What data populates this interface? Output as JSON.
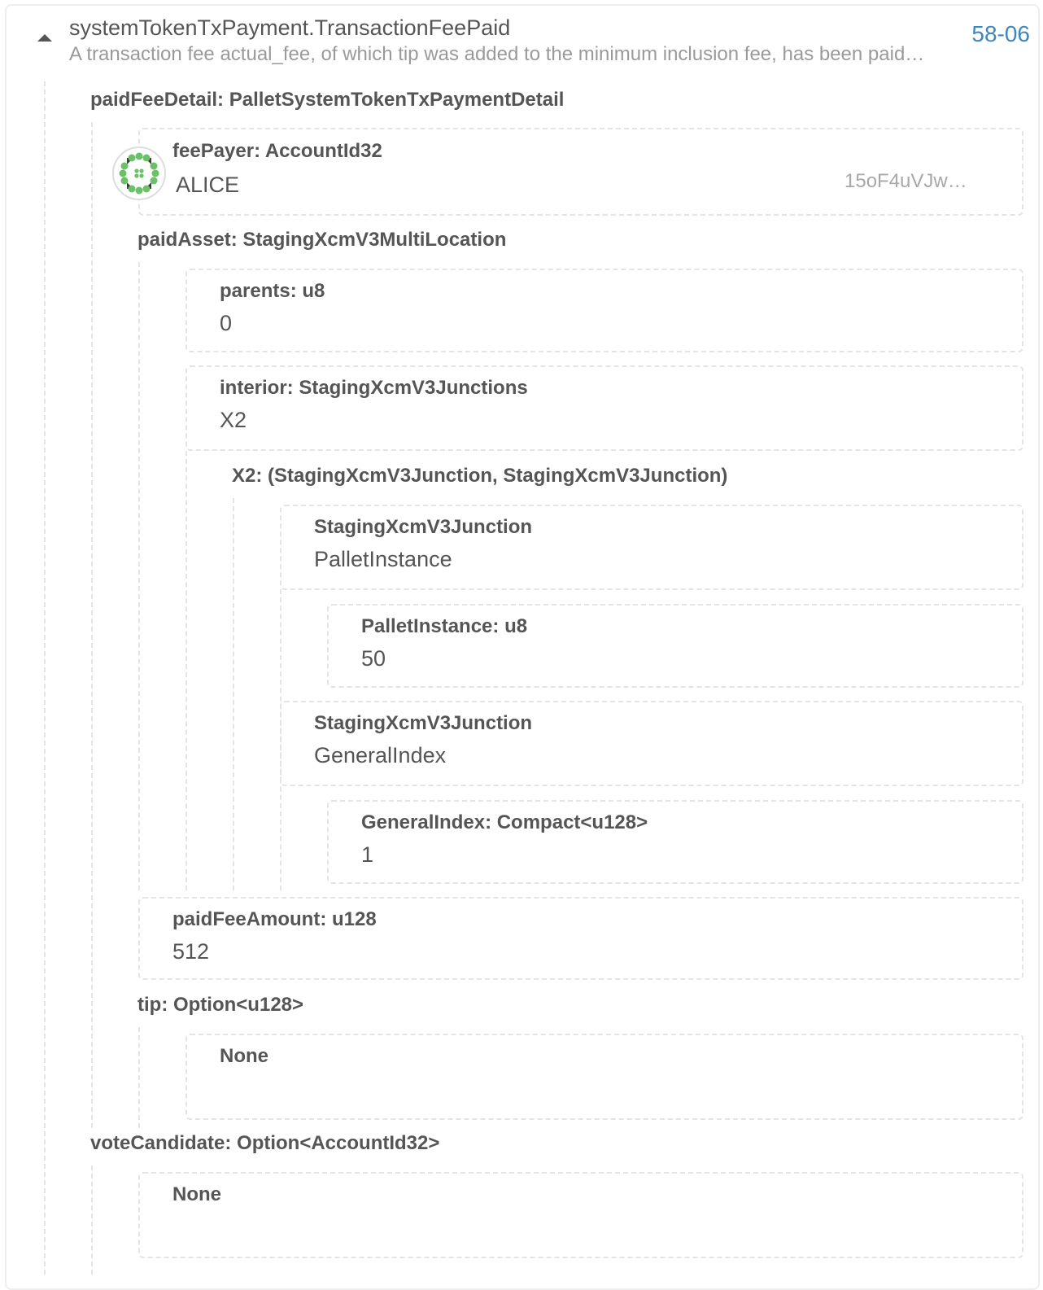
{
  "event": {
    "title": "systemTokenTxPayment.TransactionFeePaid",
    "description": "A transaction fee actual_fee, of which tip was added to the minimum inclusion fee, has been paid…",
    "link": "58-06"
  },
  "params": {
    "paid_fee_detail": {
      "label": "paidFeeDetail: PalletSystemTokenTxPaymentDetail",
      "fee_payer": {
        "label": "feePayer: AccountId32",
        "name": "ALICE",
        "address": "15oF4uVJw…"
      },
      "paid_asset": {
        "label": "paidAsset: StagingXcmV3MultiLocation",
        "parents": {
          "label": "parents: u8",
          "value": "0"
        },
        "interior": {
          "label": "interior: StagingXcmV3Junctions",
          "value": "X2",
          "x2_label": "X2: (StagingXcmV3Junction, StagingXcmV3Junction)",
          "junction_1": {
            "label": "StagingXcmV3Junction",
            "value": "PalletInstance",
            "inner": {
              "label": "PalletInstance: u8",
              "value": "50"
            }
          },
          "junction_2": {
            "label": "StagingXcmV3Junction",
            "value": "GeneralIndex",
            "inner": {
              "label": "GeneralIndex: Compact<u128>",
              "value": "1"
            }
          }
        }
      },
      "paid_fee_amount": {
        "label": "paidFeeAmount: u128",
        "value": "512"
      },
      "tip": {
        "label": "tip: Option<u128>",
        "value": "None"
      }
    },
    "vote_candidate": {
      "label": "voteCandidate: Option<AccountId32>",
      "value": "None"
    }
  },
  "colors": {
    "link": "#3f86bd",
    "dashed_border": "#e4e4e4",
    "identicon_green": "#6cc067"
  }
}
